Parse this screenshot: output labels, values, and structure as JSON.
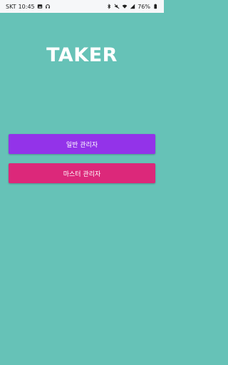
{
  "status_bar": {
    "carrier": "SKT",
    "time": "10:45",
    "battery": "76%",
    "left_icons": [
      "gallery-icon",
      "headset-icon"
    ],
    "right_icons": [
      "bluetooth-icon",
      "mute-icon",
      "wifi-icon",
      "signal-icon",
      "battery-icon"
    ]
  },
  "app": {
    "logo_text": "TAKER",
    "background_color": "#66c2b7"
  },
  "buttons": {
    "general_admin": {
      "label": "일반 관리자",
      "color": "#9333e9"
    },
    "master_admin": {
      "label": "마스터 관리자",
      "color": "#dc287a"
    }
  }
}
